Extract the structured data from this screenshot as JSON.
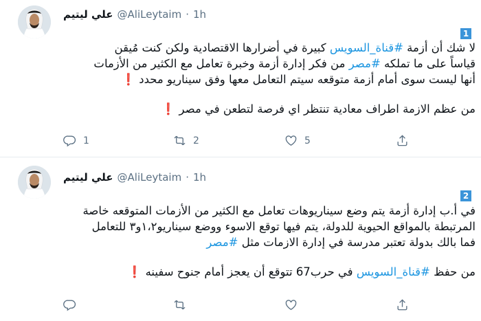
{
  "tweets": [
    {
      "thread_index": "1",
      "author": {
        "name": "علي ليتيم",
        "handle": "@AliLeytaim",
        "time": "1h"
      },
      "lines": [
        [
          {
            "t": "لا شك أن أزمة "
          },
          {
            "t": "#قناة_السويس",
            "tag": true
          },
          {
            "t": " كبيرة في أضرارها الاقتصادية ولكن كنت مُيقن"
          }
        ],
        [
          {
            "t": "قياساً على ما تملكه "
          },
          {
            "t": "#مصر",
            "tag": true
          },
          {
            "t": " من فكر إدارة أزمة وخبرة تعامل مع الكثير من الأزمات"
          }
        ],
        [
          {
            "t": "أنها ليست سوى أمام أزمة متوقعه سيتم التعامل معها وفق سيناريو محدد "
          },
          {
            "t": "❗",
            "excl": true
          }
        ],
        [
          {
            "t": "من عظم الازمة اطراف معادية تنتظر اي فرصة لتطعن في مصر "
          },
          {
            "t": "❗",
            "excl": true
          }
        ]
      ],
      "actions": {
        "replies": "1",
        "retweets": "2",
        "likes": "5"
      }
    },
    {
      "thread_index": "2",
      "author": {
        "name": "علي ليتيم",
        "handle": "@AliLeytaim",
        "time": "1h"
      },
      "lines": [
        [
          {
            "t": "في أ.ب إدارة أزمة يتم وضع سيناريوهات تعامل مع الكثير من الأزمات المتوقعه خاصة"
          }
        ],
        [
          {
            "t": "المرتبطة بالمواقع الحيوية للدولة، يتم فيها توقع الاسوء ووضع سيناريو١،٢و٣ للتعامل"
          }
        ],
        [
          {
            "t": "فما بالك بدولة تعتبر مدرسة في إدارة الازمات مثل "
          },
          {
            "t": "#مصر",
            "tag": true
          }
        ],
        [
          {
            "t": "من حفظ "
          },
          {
            "t": "#قناة_السويس",
            "tag": true
          },
          {
            "t": " في حرب67 تتوقع أن يعجز أمام جنوح سفينه "
          },
          {
            "t": "❗",
            "excl": true
          }
        ]
      ],
      "actions": {
        "replies": "",
        "retweets": "",
        "likes": ""
      }
    }
  ],
  "icons": {
    "reply": "reply-icon",
    "retweet": "retweet-icon",
    "like": "like-icon",
    "share": "share-icon"
  },
  "colors": {
    "hashtag": "#1b95e0",
    "exclamation": "#e0245e",
    "badge": "#3b94d9",
    "muted": "#5b7083"
  }
}
